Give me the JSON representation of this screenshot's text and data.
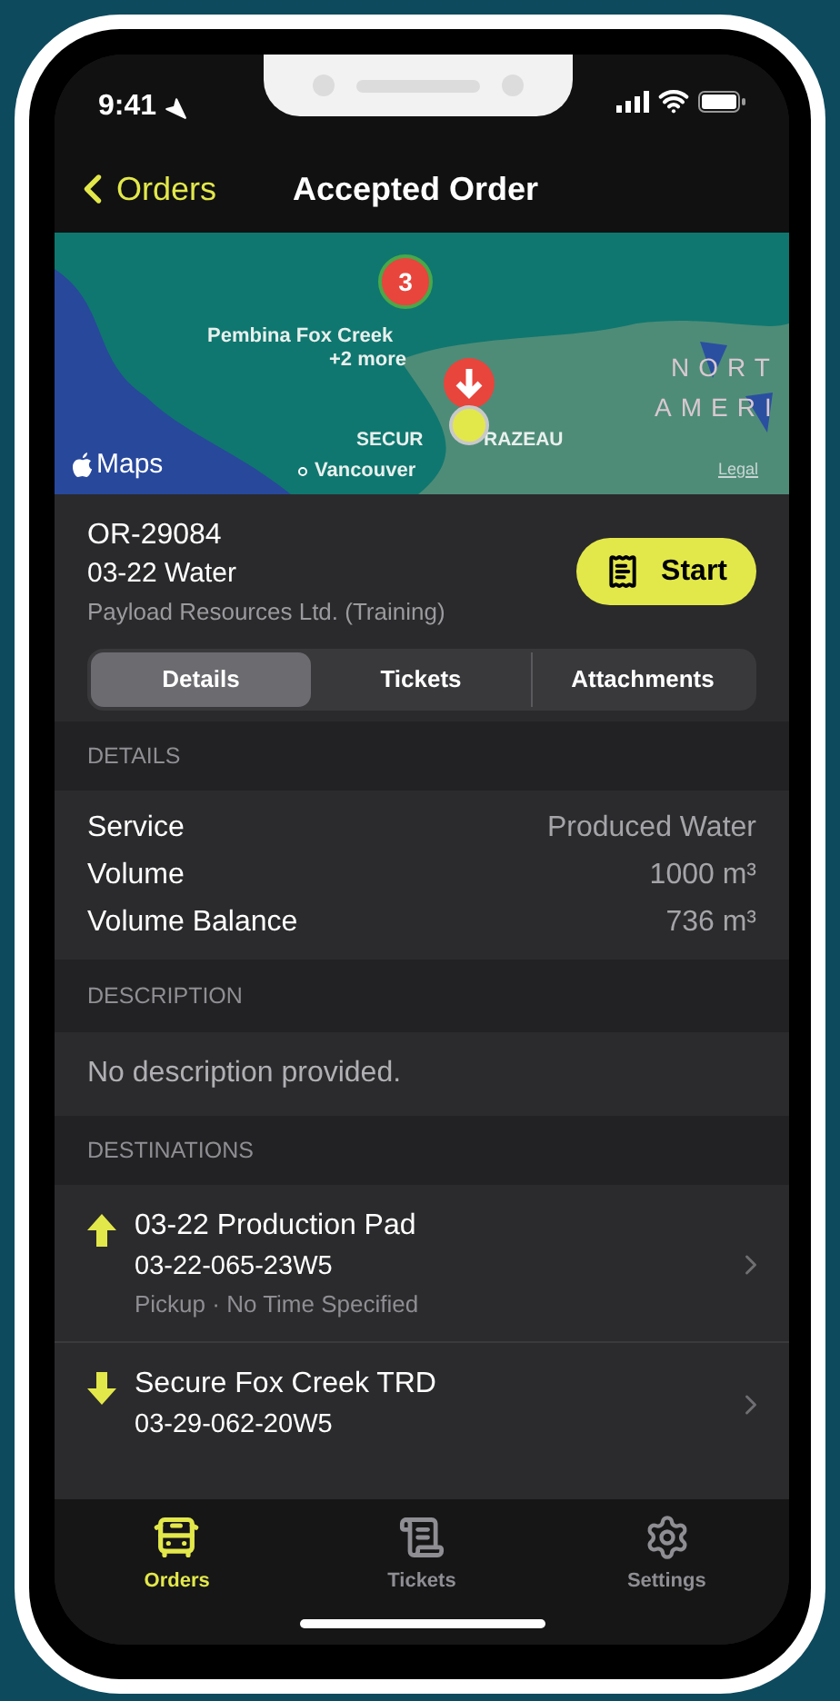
{
  "status_bar": {
    "time": "9:41"
  },
  "nav": {
    "back": "Orders",
    "title": "Accepted Order"
  },
  "map": {
    "cluster_count": "3",
    "cluster_label": "Pembina Fox Creek",
    "cluster_more": "+2 more",
    "place_left": "SECUR",
    "place_right": "RAZEAU",
    "city": "Vancouver",
    "region_line_1": "NORT",
    "region_line_2": "AMERI",
    "brand": "Maps",
    "legal": "Legal"
  },
  "order": {
    "number": "OR-29084",
    "name": "03-22 Water",
    "company": "Payload Resources Ltd. (Training)",
    "start_button": "Start"
  },
  "tabs": [
    {
      "label": "Details",
      "selected": true
    },
    {
      "label": "Tickets",
      "selected": false
    },
    {
      "label": "Attachments",
      "selected": false
    }
  ],
  "details": {
    "header": "DETAILS",
    "rows": [
      {
        "label": "Service",
        "value": "Produced Water"
      },
      {
        "label": "Volume",
        "value": "1000 m³"
      },
      {
        "label": "Volume Balance",
        "value": "736 m³"
      }
    ]
  },
  "description": {
    "header": "DESCRIPTION",
    "text": "No description provided."
  },
  "destinations": {
    "header": "DESTINATIONS",
    "items": [
      {
        "kind": "pickup",
        "name": "03-22 Production Pad",
        "location": "03-22-065-23W5",
        "note": "Pickup · No Time Specified"
      },
      {
        "kind": "dropoff",
        "name": "Secure Fox Creek TRD",
        "location": "03-29-062-20W5"
      }
    ]
  },
  "tab_bar": [
    {
      "kind": "orders",
      "label": "Orders",
      "selected": true
    },
    {
      "kind": "tickets",
      "label": "Tickets",
      "selected": false
    },
    {
      "kind": "settings",
      "label": "Settings",
      "selected": false
    }
  ]
}
